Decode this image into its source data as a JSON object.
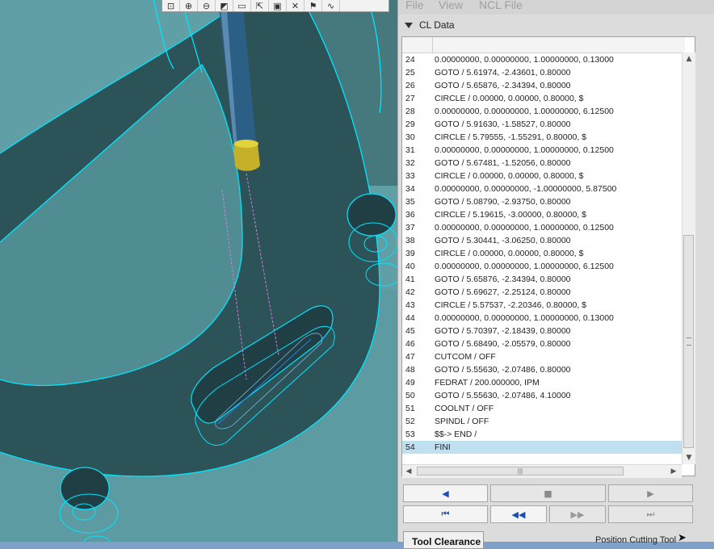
{
  "menu": {
    "file": "File",
    "view": "View",
    "ncl_file": "NCL File"
  },
  "cl_section": {
    "title": "CL Data"
  },
  "cl_rows": [
    {
      "n": "24",
      "text": "0.00000000, 0.00000000, 1.00000000,  0.13000"
    },
    {
      "n": "25",
      "text": "GOTO / 5.61974, -2.43601, 0.80000"
    },
    {
      "n": "26",
      "text": "GOTO / 5.65876, -2.34394, 0.80000"
    },
    {
      "n": "27",
      "text": "CIRCLE / 0.00000, 0.00000, 0.80000,  $"
    },
    {
      "n": "28",
      "text": "0.00000000, 0.00000000, 1.00000000,  6.12500"
    },
    {
      "n": "29",
      "text": "GOTO / 5.91630, -1.58527, 0.80000"
    },
    {
      "n": "30",
      "text": "CIRCLE / 5.79555, -1.55291, 0.80000,  $"
    },
    {
      "n": "31",
      "text": "0.00000000, 0.00000000, 1.00000000,  0.12500"
    },
    {
      "n": "32",
      "text": "GOTO / 5.67481, -1.52056, 0.80000"
    },
    {
      "n": "33",
      "text": "CIRCLE / 0.00000, 0.00000, 0.80000,  $"
    },
    {
      "n": "34",
      "text": "0.00000000, 0.00000000, -1.00000000,  5.87500"
    },
    {
      "n": "35",
      "text": "GOTO / 5.08790, -2.93750, 0.80000"
    },
    {
      "n": "36",
      "text": "CIRCLE / 5.19615, -3.00000, 0.80000,  $"
    },
    {
      "n": "37",
      "text": "0.00000000, 0.00000000, 1.00000000,  0.12500"
    },
    {
      "n": "38",
      "text": "GOTO / 5.30441, -3.06250, 0.80000"
    },
    {
      "n": "39",
      "text": "CIRCLE / 0.00000, 0.00000, 0.80000,  $"
    },
    {
      "n": "40",
      "text": "0.00000000, 0.00000000, 1.00000000,  6.12500"
    },
    {
      "n": "41",
      "text": "GOTO / 5.65876, -2.34394, 0.80000"
    },
    {
      "n": "42",
      "text": "GOTO / 5.69627, -2.25124, 0.80000"
    },
    {
      "n": "43",
      "text": "CIRCLE / 5.57537, -2.20346, 0.80000,  $"
    },
    {
      "n": "44",
      "text": "0.00000000, 0.00000000, 1.00000000,  0.13000"
    },
    {
      "n": "45",
      "text": "GOTO / 5.70397, -2.18439, 0.80000"
    },
    {
      "n": "46",
      "text": "GOTO / 5.68490, -2.05579, 0.80000"
    },
    {
      "n": "47",
      "text": "CUTCOM / OFF"
    },
    {
      "n": "48",
      "text": "GOTO / 5.55630, -2.07486, 0.80000"
    },
    {
      "n": "49",
      "text": "FEDRAT / 200.000000,  IPM"
    },
    {
      "n": "50",
      "text": "GOTO / 5.55630, -2.07486, 4.10000"
    },
    {
      "n": "51",
      "text": "COOLNT / OFF"
    },
    {
      "n": "52",
      "text": "SPINDL / OFF"
    },
    {
      "n": "53",
      "text": "$$-> END /"
    },
    {
      "n": "54",
      "text": "FINI"
    }
  ],
  "selected_row": "54",
  "buttons": {
    "tool_clearance": "Tool Clearance",
    "position_cutting_tool": "Position Cutting Tool"
  },
  "playback_icons": [
    "step-back-icon",
    "stop-icon",
    "play-icon",
    "rewind-start-icon",
    "fast-back-icon",
    "fast-forward-icon",
    "forward-end-icon"
  ],
  "viewport_icons": [
    "zoom-extents-icon",
    "zoom-in-icon",
    "zoom-out-icon",
    "shade-icon",
    "view-icon",
    "fit-icon",
    "camera-icon",
    "tool-icon",
    "flag-icon",
    "path-icon"
  ],
  "colors": {
    "part_face": "#5d9ea4",
    "part_shadow": "#2c5459",
    "edge": "#00e6ff",
    "tool_holder": "#2b5f86",
    "tool_tip": "#c6b02a",
    "toolpath": "#d27fd6",
    "selection": "#bfe0f0"
  }
}
